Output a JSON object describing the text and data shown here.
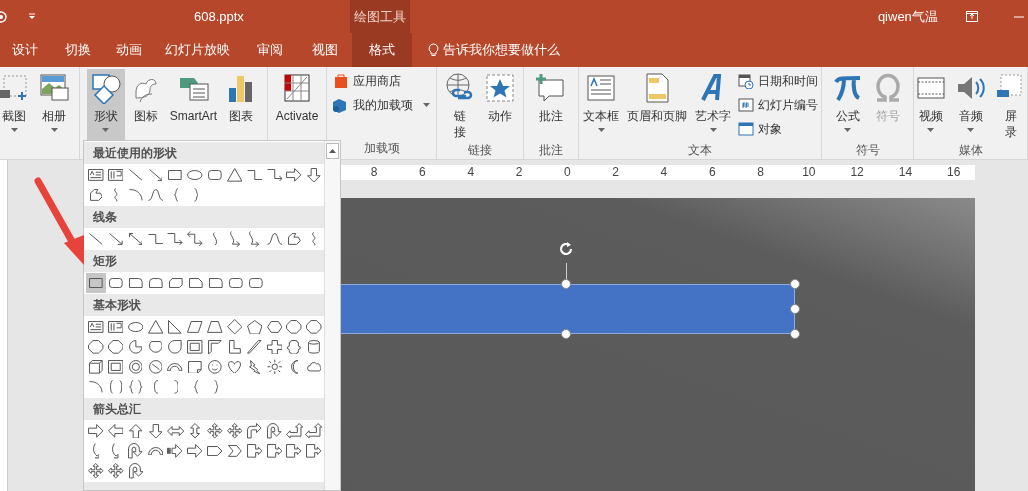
{
  "title_bar": {
    "file_title": "608.pptx",
    "context_tab": "绘图工具",
    "user": "qiwen气温"
  },
  "tabs": [
    {
      "label": "设计",
      "selected": false
    },
    {
      "label": "切换",
      "selected": false
    },
    {
      "label": "动画",
      "selected": false
    },
    {
      "label": "幻灯片放映",
      "selected": false
    },
    {
      "label": "审阅",
      "selected": false
    },
    {
      "label": "视图",
      "selected": false
    },
    {
      "label": "格式",
      "selected": true
    }
  ],
  "tell_me": "告诉我你想要做什么",
  "ribbon_groups": [
    {
      "items": [
        {
          "kind": "large",
          "label": "截图",
          "dropdown": true,
          "pressed": false,
          "disabled": false
        },
        {
          "kind": "large",
          "label": "相册",
          "dropdown": true,
          "pressed": false,
          "disabled": false
        }
      ]
    },
    {
      "items": [
        {
          "kind": "large",
          "label": "形状",
          "dropdown": true,
          "pressed": true,
          "disabled": false
        },
        {
          "kind": "large",
          "label": "图标",
          "dropdown": false,
          "pressed": false,
          "disabled": false
        },
        {
          "kind": "large",
          "label": "SmartArt",
          "dropdown": false,
          "pressed": false,
          "disabled": false
        },
        {
          "kind": "large",
          "label": "图表",
          "dropdown": false,
          "pressed": false,
          "disabled": false
        }
      ]
    },
    {
      "items": [
        {
          "kind": "large",
          "label": "Activate",
          "dropdown": false,
          "pressed": false,
          "disabled": false
        }
      ]
    },
    {
      "label": "加载项",
      "items": [
        {
          "kind": "small",
          "label": "应用商店",
          "dropdown": false,
          "pressed": false,
          "disabled": false
        },
        {
          "kind": "small",
          "label": "我的加载项",
          "dropdown": true,
          "pressed": false,
          "disabled": false
        }
      ]
    },
    {
      "label": "链接",
      "items": [
        {
          "kind": "tall",
          "label": "链接",
          "pressed": false,
          "disabled": false
        },
        {
          "kind": "large",
          "label": "动作",
          "dropdown": false,
          "pressed": false,
          "disabled": false
        }
      ]
    },
    {
      "label": "批注",
      "items": [
        {
          "kind": "large",
          "label": "批注",
          "dropdown": false,
          "pressed": false,
          "disabled": false
        }
      ]
    },
    {
      "label": "文本",
      "items": [
        {
          "kind": "large",
          "label": "文本框",
          "dropdown": true,
          "pressed": false,
          "disabled": false
        },
        {
          "kind": "large",
          "label": "页眉和页脚",
          "dropdown": false,
          "pressed": false,
          "disabled": false
        },
        {
          "kind": "large",
          "label": "艺术字",
          "dropdown": true,
          "pressed": false,
          "disabled": false
        },
        {
          "kind": "small",
          "label": "日期和时间",
          "dropdown": false,
          "pressed": false,
          "disabled": false
        },
        {
          "kind": "small",
          "label": "幻灯片编号",
          "dropdown": false,
          "pressed": false,
          "disabled": false
        },
        {
          "kind": "small",
          "label": "对象",
          "dropdown": false,
          "pressed": false,
          "disabled": false
        }
      ]
    },
    {
      "label": "符号",
      "items": [
        {
          "kind": "large",
          "label": "公式",
          "dropdown": true,
          "pressed": false,
          "disabled": false
        },
        {
          "kind": "large",
          "label": "符号",
          "dropdown": false,
          "pressed": false,
          "disabled": true
        }
      ]
    },
    {
      "label": "媒体",
      "items": [
        {
          "kind": "large",
          "label": "视频",
          "dropdown": true,
          "pressed": false,
          "disabled": false
        },
        {
          "kind": "large",
          "label": "音频",
          "dropdown": true,
          "pressed": false,
          "disabled": false
        },
        {
          "kind": "tall",
          "label": "屏录",
          "pressed": false,
          "disabled": false
        }
      ]
    }
  ],
  "shape_gallery": {
    "sections": [
      {
        "title": "最近使用的形状",
        "first_shape_selected": false
      },
      {
        "title": "线条",
        "first_shape_selected": false
      },
      {
        "title": "矩形",
        "first_shape_selected": true
      },
      {
        "title": "基本形状",
        "first_shape_selected": false
      },
      {
        "title": "箭头总汇",
        "first_shape_selected": false
      }
    ]
  },
  "ruler": {
    "labels": [
      "8",
      "6",
      "4",
      "2",
      "0",
      "2",
      "4",
      "6",
      "8",
      "10",
      "12",
      "14",
      "16"
    ]
  }
}
